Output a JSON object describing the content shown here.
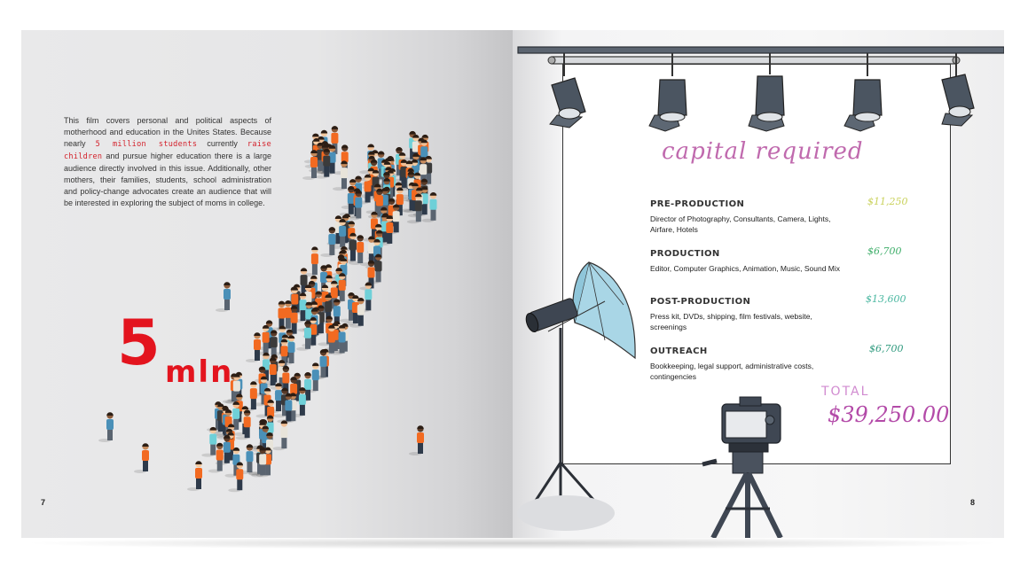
{
  "left_page": {
    "intro": {
      "part1": "This film covers personal and political aspects of motherhood and education in the Unites States. Because nearly ",
      "highlight1": "5 million students",
      "part2": " currently ",
      "highlight2": "raise children",
      "part3": " and pursue higher education there is a large audience directly involved in this issue. Additionally, other mothers, their families, students, school administration and policy-change advocates create an audience that will be interested in exploring the subject of moms in college."
    },
    "big_number": "5",
    "big_unit": "mln",
    "page_number": "7"
  },
  "right_page": {
    "title": "capital required",
    "sections": [
      {
        "heading": "PRE-PRODUCTION",
        "description": "Director of Photography, Consultants, Camera, Lights, Airfare, Hotels",
        "amount": "$11,250",
        "color": "#c9d15a"
      },
      {
        "heading": "PRODUCTION",
        "description": "Editor, Computer Graphics, Animation, Music, Sound Mix",
        "amount": "$6,700",
        "color": "#3fae6a"
      },
      {
        "heading": "POST-PRODUCTION",
        "description": "Press kit, DVDs, shipping, film festivals, website, screenings",
        "amount": "$13,600",
        "color": "#49b7a0"
      },
      {
        "heading": "OUTREACH",
        "description": "Bookkeeping, legal support, administrative costs, contingencies",
        "amount": "$6,700",
        "color": "#2f9a7e"
      }
    ],
    "total_label": "TOTAL",
    "total_amount": "$39,250.00",
    "page_number": "8"
  },
  "colors": {
    "accent_red": "#e3141e",
    "title_pink": "#c06aae",
    "total_purple": "#b34aa8"
  },
  "icons": [
    "spotlight-icon",
    "umbrella-light-icon",
    "camera-icon",
    "tripod-icon",
    "person-figure-icon"
  ]
}
